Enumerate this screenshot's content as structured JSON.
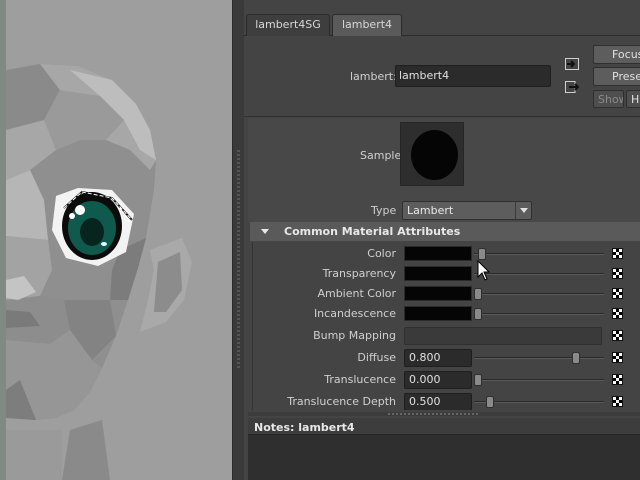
{
  "tabs": [
    {
      "label": "lambert4SG"
    },
    {
      "label": "lambert4"
    }
  ],
  "header": {
    "name_label": "lambert:",
    "name_value": "lambert4",
    "buttons": {
      "focus": "Focus",
      "presets": "Presets",
      "show": "Show",
      "hide": "H"
    }
  },
  "sample": {
    "label": "Sample"
  },
  "type": {
    "label": "Type",
    "value": "Lambert"
  },
  "section": {
    "title": "Common Material Attributes"
  },
  "attributes": [
    {
      "label": "Color",
      "kind": "color",
      "slider": 0.03
    },
    {
      "label": "Transparency",
      "kind": "color",
      "slider": 0.0
    },
    {
      "label": "Ambient Color",
      "kind": "color",
      "slider": 0.0
    },
    {
      "label": "Incandescence",
      "kind": "color",
      "slider": 0.0
    },
    {
      "label": "Bump Mapping",
      "kind": "bump"
    },
    {
      "label": "Diffuse",
      "kind": "number",
      "value": "0.800",
      "slider": 0.8
    },
    {
      "label": "Translucence",
      "kind": "number",
      "value": "0.000",
      "slider": 0.0
    },
    {
      "label": "Translucence Depth",
      "kind": "number",
      "value": "0.500",
      "slider": 0.1
    }
  ],
  "notes": {
    "label": "Notes:  lambert4"
  },
  "colors": {
    "panel": "#444444",
    "viewport": "#9e9e9e",
    "field": "#2b2b2b",
    "swatch": "#050505",
    "iris": "#0f5a4c"
  }
}
